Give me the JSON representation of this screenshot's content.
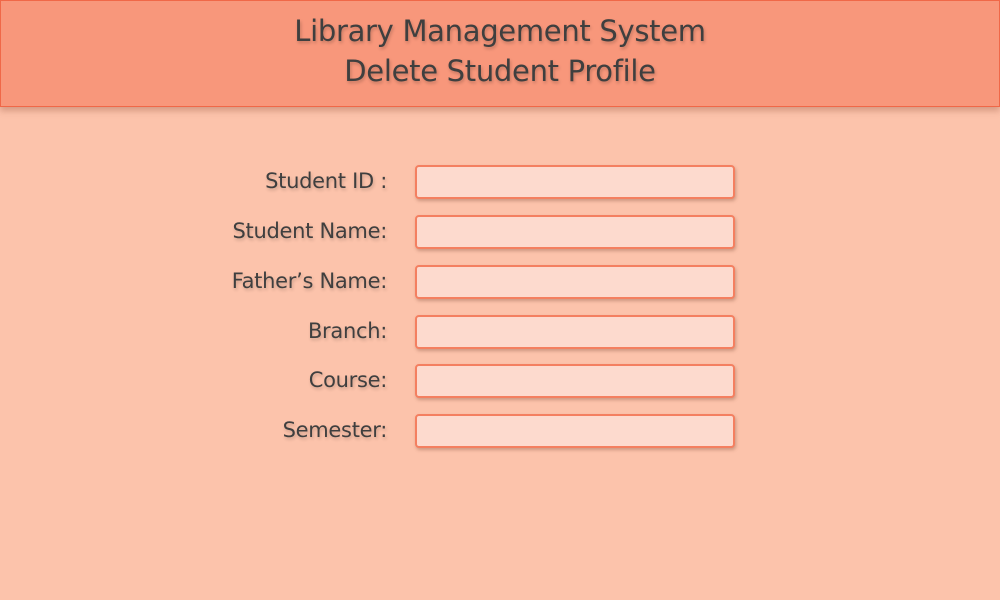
{
  "header": {
    "app_title": "Library Management System",
    "page_title": "Delete Student Profile"
  },
  "form": {
    "fields": [
      {
        "label": "Student ID :",
        "value": ""
      },
      {
        "label": "Student Name:",
        "value": ""
      },
      {
        "label": "Father’s Name:",
        "value": ""
      },
      {
        "label": "Branch:",
        "value": ""
      },
      {
        "label": "Course:",
        "value": ""
      },
      {
        "label": "Semester:",
        "value": ""
      }
    ]
  },
  "colors": {
    "background": "#fcc3ab",
    "header_background": "#f8977b",
    "field_background": "#fddace",
    "field_border": "#f47f60",
    "text": "#3f3f3f"
  }
}
